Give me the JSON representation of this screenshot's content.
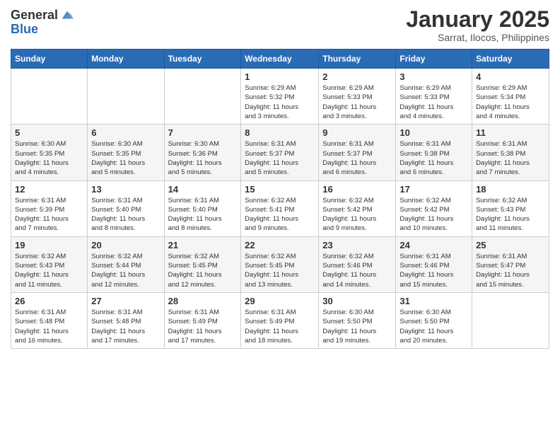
{
  "logo": {
    "general": "General",
    "blue": "Blue"
  },
  "title": "January 2025",
  "location": "Sarrat, Ilocos, Philippines",
  "weekdays": [
    "Sunday",
    "Monday",
    "Tuesday",
    "Wednesday",
    "Thursday",
    "Friday",
    "Saturday"
  ],
  "weeks": [
    [
      {
        "day": "",
        "info": ""
      },
      {
        "day": "",
        "info": ""
      },
      {
        "day": "",
        "info": ""
      },
      {
        "day": "1",
        "info": "Sunrise: 6:29 AM\nSunset: 5:32 PM\nDaylight: 11 hours\nand 3 minutes."
      },
      {
        "day": "2",
        "info": "Sunrise: 6:29 AM\nSunset: 5:33 PM\nDaylight: 11 hours\nand 3 minutes."
      },
      {
        "day": "3",
        "info": "Sunrise: 6:29 AM\nSunset: 5:33 PM\nDaylight: 11 hours\nand 4 minutes."
      },
      {
        "day": "4",
        "info": "Sunrise: 6:29 AM\nSunset: 5:34 PM\nDaylight: 11 hours\nand 4 minutes."
      }
    ],
    [
      {
        "day": "5",
        "info": "Sunrise: 6:30 AM\nSunset: 5:35 PM\nDaylight: 11 hours\nand 4 minutes."
      },
      {
        "day": "6",
        "info": "Sunrise: 6:30 AM\nSunset: 5:35 PM\nDaylight: 11 hours\nand 5 minutes."
      },
      {
        "day": "7",
        "info": "Sunrise: 6:30 AM\nSunset: 5:36 PM\nDaylight: 11 hours\nand 5 minutes."
      },
      {
        "day": "8",
        "info": "Sunrise: 6:31 AM\nSunset: 5:37 PM\nDaylight: 11 hours\nand 5 minutes."
      },
      {
        "day": "9",
        "info": "Sunrise: 6:31 AM\nSunset: 5:37 PM\nDaylight: 11 hours\nand 6 minutes."
      },
      {
        "day": "10",
        "info": "Sunrise: 6:31 AM\nSunset: 5:38 PM\nDaylight: 11 hours\nand 6 minutes."
      },
      {
        "day": "11",
        "info": "Sunrise: 6:31 AM\nSunset: 5:38 PM\nDaylight: 11 hours\nand 7 minutes."
      }
    ],
    [
      {
        "day": "12",
        "info": "Sunrise: 6:31 AM\nSunset: 5:39 PM\nDaylight: 11 hours\nand 7 minutes."
      },
      {
        "day": "13",
        "info": "Sunrise: 6:31 AM\nSunset: 5:40 PM\nDaylight: 11 hours\nand 8 minutes."
      },
      {
        "day": "14",
        "info": "Sunrise: 6:31 AM\nSunset: 5:40 PM\nDaylight: 11 hours\nand 8 minutes."
      },
      {
        "day": "15",
        "info": "Sunrise: 6:32 AM\nSunset: 5:41 PM\nDaylight: 11 hours\nand 9 minutes."
      },
      {
        "day": "16",
        "info": "Sunrise: 6:32 AM\nSunset: 5:42 PM\nDaylight: 11 hours\nand 9 minutes."
      },
      {
        "day": "17",
        "info": "Sunrise: 6:32 AM\nSunset: 5:42 PM\nDaylight: 11 hours\nand 10 minutes."
      },
      {
        "day": "18",
        "info": "Sunrise: 6:32 AM\nSunset: 5:43 PM\nDaylight: 11 hours\nand 11 minutes."
      }
    ],
    [
      {
        "day": "19",
        "info": "Sunrise: 6:32 AM\nSunset: 5:43 PM\nDaylight: 11 hours\nand 11 minutes."
      },
      {
        "day": "20",
        "info": "Sunrise: 6:32 AM\nSunset: 5:44 PM\nDaylight: 11 hours\nand 12 minutes."
      },
      {
        "day": "21",
        "info": "Sunrise: 6:32 AM\nSunset: 5:45 PM\nDaylight: 11 hours\nand 12 minutes."
      },
      {
        "day": "22",
        "info": "Sunrise: 6:32 AM\nSunset: 5:45 PM\nDaylight: 11 hours\nand 13 minutes."
      },
      {
        "day": "23",
        "info": "Sunrise: 6:32 AM\nSunset: 5:46 PM\nDaylight: 11 hours\nand 14 minutes."
      },
      {
        "day": "24",
        "info": "Sunrise: 6:31 AM\nSunset: 5:46 PM\nDaylight: 11 hours\nand 15 minutes."
      },
      {
        "day": "25",
        "info": "Sunrise: 6:31 AM\nSunset: 5:47 PM\nDaylight: 11 hours\nand 15 minutes."
      }
    ],
    [
      {
        "day": "26",
        "info": "Sunrise: 6:31 AM\nSunset: 5:48 PM\nDaylight: 11 hours\nand 16 minutes."
      },
      {
        "day": "27",
        "info": "Sunrise: 6:31 AM\nSunset: 5:48 PM\nDaylight: 11 hours\nand 17 minutes."
      },
      {
        "day": "28",
        "info": "Sunrise: 6:31 AM\nSunset: 5:49 PM\nDaylight: 11 hours\nand 17 minutes."
      },
      {
        "day": "29",
        "info": "Sunrise: 6:31 AM\nSunset: 5:49 PM\nDaylight: 11 hours\nand 18 minutes."
      },
      {
        "day": "30",
        "info": "Sunrise: 6:30 AM\nSunset: 5:50 PM\nDaylight: 11 hours\nand 19 minutes."
      },
      {
        "day": "31",
        "info": "Sunrise: 6:30 AM\nSunset: 5:50 PM\nDaylight: 11 hours\nand 20 minutes."
      },
      {
        "day": "",
        "info": ""
      }
    ]
  ]
}
